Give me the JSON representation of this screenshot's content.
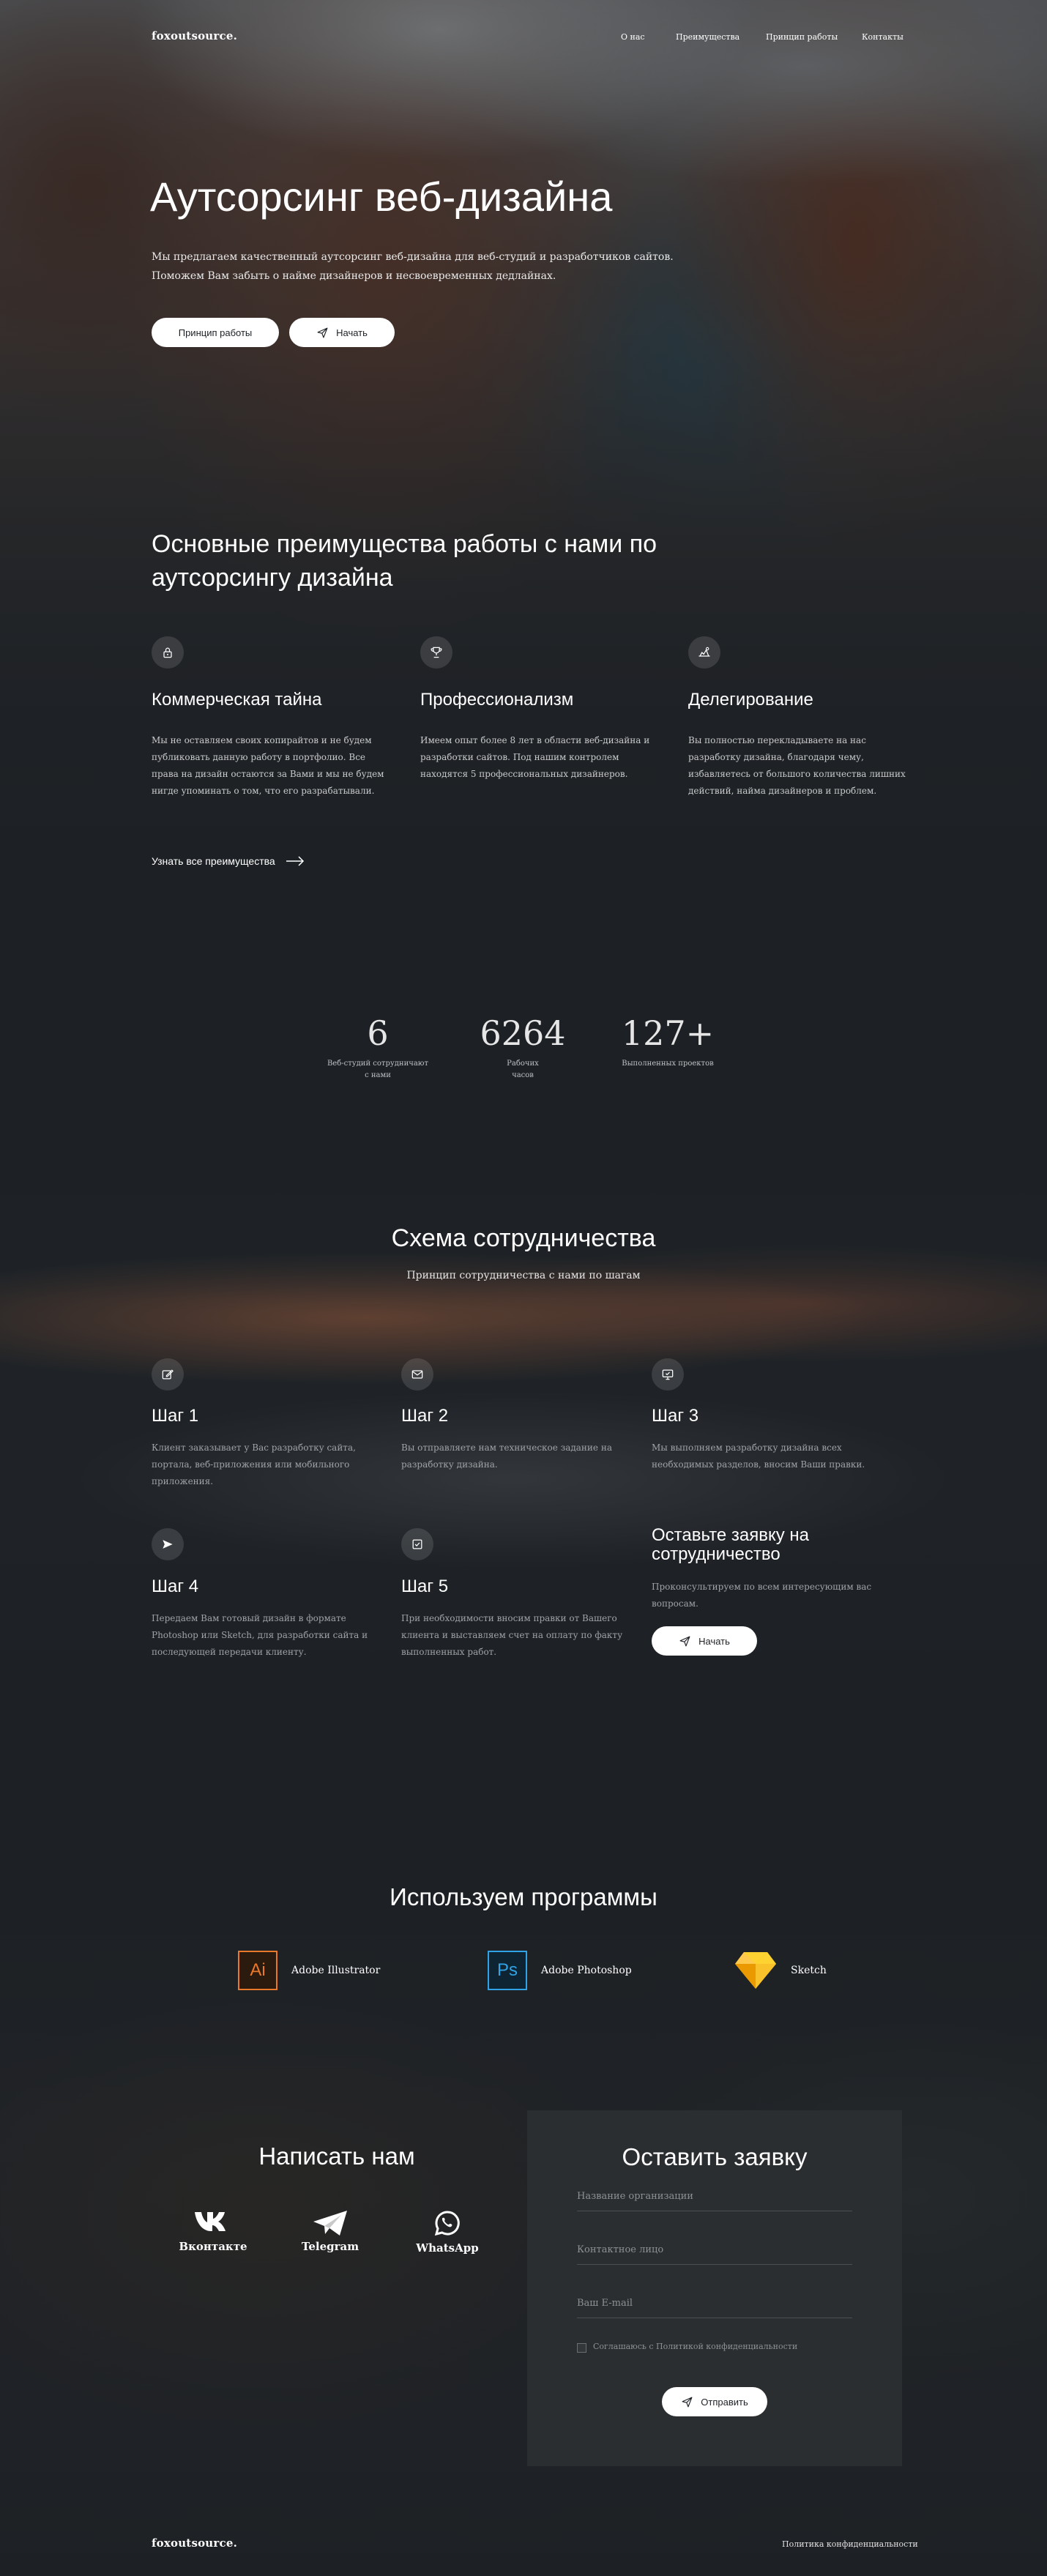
{
  "header": {
    "logo": "foxoutsource.",
    "nav": [
      "О нас",
      "Преимущества",
      "Принцип работы",
      "Контакты"
    ]
  },
  "hero": {
    "title": "Аутсорсинг веб-дизайна",
    "lead_line1": "Мы предлагаем качественный аутсорсинг веб-дизайна для веб-студий и разработчиков сайтов.",
    "lead_line2": "Поможем Вам забыть о найме дизайнеров и несвоевременных дедлайнах.",
    "btn_principle": "Принцип работы",
    "btn_start": "Начать"
  },
  "advantages": {
    "title_line1": "Основные преимущества работы с нами по",
    "title_line2": "аутсорсингу дизайна",
    "items": [
      {
        "icon": "lock-icon",
        "title": "Коммерческая тайна",
        "text": [
          "Мы не оставляем своих копирайтов и не будем",
          "публиковать данную работу в портфолио. Все",
          "права на дизайн остаются за Вами и мы не будем",
          "нигде упоминать о том, что его разрабатывали."
        ]
      },
      {
        "icon": "trophy-icon",
        "title": "Профессионализм",
        "text": [
          "Имеем опыт более 8 лет в области веб-дизайна и",
          "разработки сайтов. Под нашим контролем",
          "находятся 5 профессиональных дизайнеров."
        ]
      },
      {
        "icon": "delegate-icon",
        "title": "Делегирование",
        "text": [
          "Вы полностью перекладываете на нас",
          "разработку дизайна, благодаря чему,",
          "избавляетесь от большого количества лишних",
          "действий, найма дизайнеров и проблем."
        ]
      }
    ],
    "link": "Узнать все преимущества"
  },
  "stats": [
    {
      "value": "6",
      "label_line1": "Веб-студий сотрудничают",
      "label_line2": "с нами"
    },
    {
      "value": "6264",
      "label_line1": "Рабочих",
      "label_line2": "часов"
    },
    {
      "value": "127+",
      "label_line1": "Выполненных проектов",
      "label_line2": ""
    }
  ],
  "scheme": {
    "title": "Схема сотрудничества",
    "subtitle": "Принцип сотрудничества с нами по шагам",
    "steps": [
      {
        "icon": "edit-icon",
        "title": "Шаг 1",
        "text": [
          "Клиент заказывает у Вас разработку сайта,",
          "портала, веб-приложения или мобильного",
          "приложения."
        ]
      },
      {
        "icon": "mail-icon",
        "title": "Шаг 2",
        "text": [
          "Вы отправляете нам техническое задание на",
          "разработку дизайна."
        ]
      },
      {
        "icon": "monitor-check-icon",
        "title": "Шаг 3",
        "text": [
          "Мы выполняем разработку дизайна всех",
          "необходимых разделов, вносим Ваши правки."
        ]
      },
      {
        "icon": "send-icon",
        "title": "Шаг 4",
        "text": [
          "Передаем Вам готовый дизайн в формате",
          "Photoshop или Sketch, для разработки сайта и",
          "последующей передачи клиенту."
        ]
      },
      {
        "icon": "checkbox-icon",
        "title": "Шаг 5",
        "text": [
          "При необходимости вносим правки от Вашего",
          "клиента и выставляем счет на оплату по факту",
          "выполненных работ."
        ]
      }
    ],
    "cta_title_line1": "Оставьте заявку на",
    "cta_title_line2": "сотрудничество",
    "cta_text_line1": "Проконсультируем по всем интересующим вас",
    "cta_text_line2": "вопросам.",
    "cta_button": "Начать"
  },
  "programs": {
    "title": "Используем программы",
    "items": [
      {
        "icon": "illustrator-icon",
        "badge": "Ai",
        "name": "Adobe Illustrator"
      },
      {
        "icon": "photoshop-icon",
        "badge": "Ps",
        "name": "Adobe Photoshop"
      },
      {
        "icon": "sketch-icon",
        "badge": "",
        "name": "Sketch"
      }
    ]
  },
  "contacts": {
    "title": "Написать нам",
    "items": [
      {
        "icon": "vk-icon",
        "label": "Вконтакте"
      },
      {
        "icon": "telegram-icon",
        "label": "Telegram"
      },
      {
        "icon": "whatsapp-icon",
        "label": "WhatsApp"
      }
    ]
  },
  "form": {
    "title": "Оставить заявку",
    "org_placeholder": "Название организации",
    "person_placeholder": "Контактное лицо",
    "email_placeholder": "Ваш E-mail",
    "consent": "Соглашаюсь с Политикой конфиденциальности",
    "submit": "Отправить"
  },
  "footer": {
    "logo": "foxoutsource.",
    "privacy": "Политика конфиденциальности"
  }
}
